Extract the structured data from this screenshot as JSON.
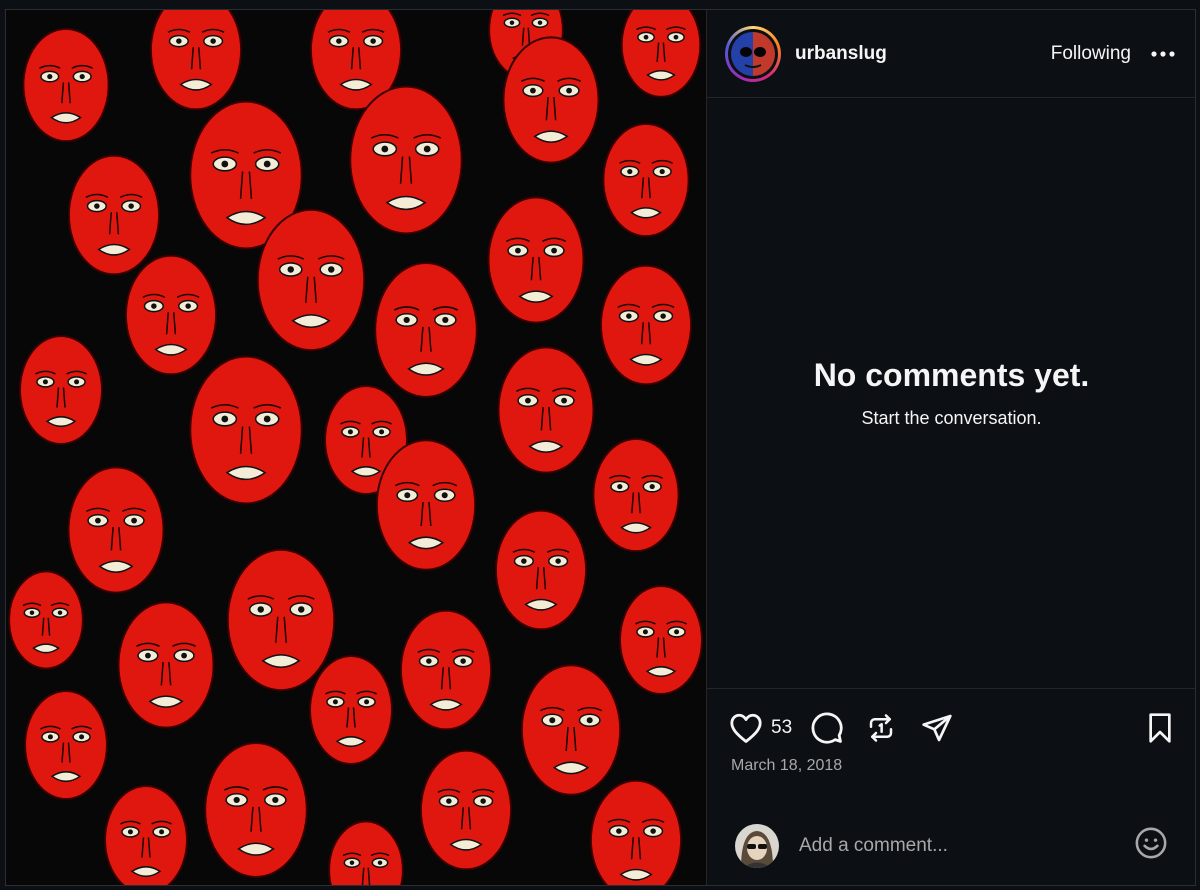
{
  "post": {
    "username": "urbanslug",
    "follow_state": "Following",
    "likes": "53",
    "date": "March 18, 2018"
  },
  "comments": {
    "empty_title": "No comments yet.",
    "empty_subtitle": "Start the conversation."
  },
  "composer": {
    "placeholder": "Add a comment..."
  },
  "icons": {
    "more": "more-horizontal-icon",
    "like": "heart-icon",
    "comment": "comment-bubble-icon",
    "repost": "repost-icon",
    "share": "send-icon",
    "save": "bookmark-icon",
    "emoji": "emoji-icon"
  },
  "colors": {
    "background": "#0c1014",
    "face_red": "#e0170f",
    "secondary_text": "#a8a8a8"
  }
}
